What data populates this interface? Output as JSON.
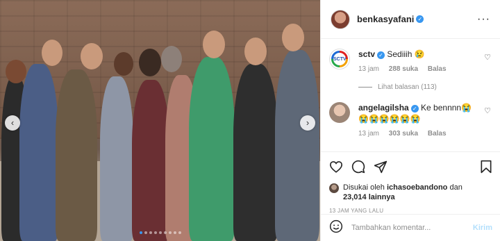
{
  "post": {
    "username": "benkasyafani",
    "image_alt": "Group photo of ten people on a set",
    "carousel": {
      "dots": 9,
      "active_index": 0
    }
  },
  "icons": {
    "prev": "chevron-left-icon",
    "next": "chevron-right-icon",
    "more": "more-options-icon",
    "verified": "verified-badge-icon"
  },
  "comments": [
    {
      "username": "sctv",
      "text": "Sediiih 😢",
      "time": "13 jam",
      "likes": "288 suka",
      "reply": "Balas",
      "view_replies": "Lihat balasan (113)"
    },
    {
      "username": "angelagilsha",
      "text": "Ke bennnn😭😭😭😭😭😭😭",
      "time": "13 jam",
      "likes": "303 suka",
      "reply": "Balas"
    }
  ],
  "likes": {
    "prefix": "Disukai oleh",
    "user": "ichasoebandono",
    "connector": "dan",
    "count": "23,014 lainnya"
  },
  "timestamp": "13 JAM YANG LALU",
  "add_comment": {
    "placeholder": "Tambahkan komentar...",
    "post_label": "Kirim"
  },
  "colors": {
    "accent": "#3897f0",
    "post_disabled": "#b2dffc",
    "muted": "#8e8e8e"
  }
}
